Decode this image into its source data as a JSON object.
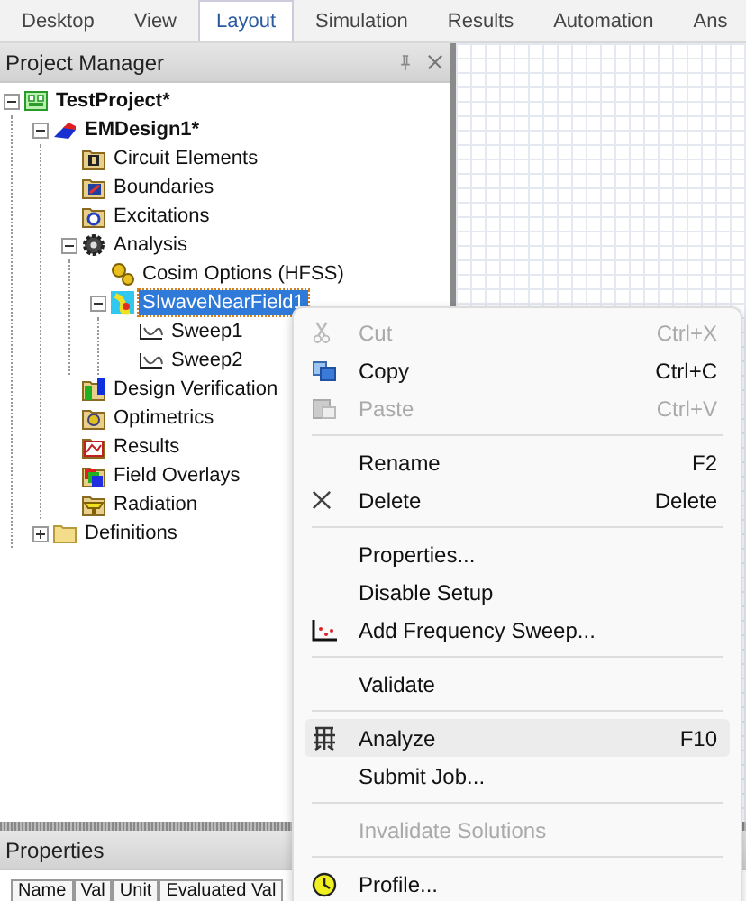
{
  "tabs": [
    {
      "label": "Desktop",
      "selected": false
    },
    {
      "label": "View",
      "selected": false
    },
    {
      "label": "Layout",
      "selected": true
    },
    {
      "label": "Simulation",
      "selected": false
    },
    {
      "label": "Results",
      "selected": false
    },
    {
      "label": "Automation",
      "selected": false
    },
    {
      "label": "Ans",
      "selected": false
    }
  ],
  "project_manager": {
    "title": "Project Manager",
    "tree": [
      {
        "label": "TestProject*",
        "expanded": true,
        "selected": false,
        "children": [
          {
            "label": "EMDesign1*",
            "expanded": true,
            "selected": false,
            "children": [
              {
                "label": "Circuit Elements",
                "selected": false
              },
              {
                "label": "Boundaries",
                "selected": false
              },
              {
                "label": "Excitations",
                "selected": false
              },
              {
                "label": "Analysis",
                "expanded": true,
                "selected": false,
                "children": [
                  {
                    "label": "Cosim Options (HFSS)",
                    "selected": false
                  },
                  {
                    "label": "SIwaveNearField1",
                    "expanded": true,
                    "selected": true,
                    "children": [
                      {
                        "label": "Sweep1",
                        "selected": false
                      },
                      {
                        "label": "Sweep2",
                        "selected": false
                      }
                    ]
                  }
                ]
              },
              {
                "label": "Design Verification",
                "selected": false
              },
              {
                "label": "Optimetrics",
                "selected": false
              },
              {
                "label": "Results",
                "selected": false
              },
              {
                "label": "Field Overlays",
                "selected": false
              },
              {
                "label": "Radiation",
                "selected": false
              }
            ]
          },
          {
            "label": "Definitions",
            "expanded": false,
            "selected": false
          }
        ]
      }
    ]
  },
  "properties": {
    "title": "Properties",
    "columns": [
      "Name",
      "Val",
      "Unit",
      "Evaluated Val"
    ]
  },
  "context_menu": [
    {
      "kind": "command",
      "label": "Cut",
      "shortcut": "Ctrl+X",
      "disabled": true,
      "selected": false
    },
    {
      "kind": "command",
      "label": "Copy",
      "shortcut": "Ctrl+C",
      "disabled": false,
      "selected": false
    },
    {
      "kind": "command",
      "label": "Paste",
      "shortcut": "Ctrl+V",
      "disabled": true,
      "selected": false
    },
    {
      "kind": "separator"
    },
    {
      "kind": "command",
      "label": "Rename",
      "shortcut": "F2",
      "disabled": false,
      "selected": false
    },
    {
      "kind": "command",
      "label": "Delete",
      "shortcut": "Delete",
      "disabled": false,
      "selected": false
    },
    {
      "kind": "separator"
    },
    {
      "kind": "command",
      "label": "Properties...",
      "disabled": false,
      "selected": false
    },
    {
      "kind": "command",
      "label": "Disable Setup",
      "disabled": false,
      "selected": false
    },
    {
      "kind": "command",
      "label": "Add Frequency Sweep...",
      "disabled": false,
      "selected": false
    },
    {
      "kind": "separator"
    },
    {
      "kind": "command",
      "label": "Validate",
      "disabled": false,
      "selected": false
    },
    {
      "kind": "separator"
    },
    {
      "kind": "command",
      "label": "Analyze",
      "shortcut": "F10",
      "disabled": false,
      "selected": true
    },
    {
      "kind": "command",
      "label": "Submit Job...",
      "disabled": false,
      "selected": false
    },
    {
      "kind": "separator"
    },
    {
      "kind": "command",
      "label": "Invalidate Solutions",
      "disabled": true,
      "selected": false
    },
    {
      "kind": "separator"
    },
    {
      "kind": "command",
      "label": "Profile...",
      "disabled": false,
      "selected": false
    }
  ]
}
